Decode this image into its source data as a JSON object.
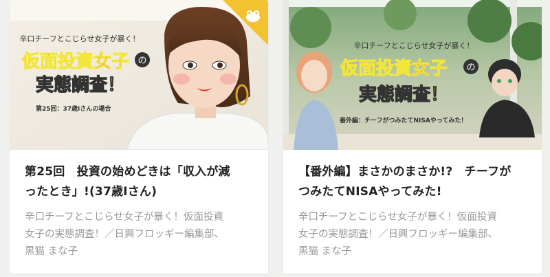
{
  "cards": [
    {
      "thumbnail": {
        "subtitle": "辛口チーフとこじらせ女子が暴く！",
        "title_line1": "仮面投資女子",
        "title_no": "の",
        "title_line2": "実態調査！",
        "caption": "第25回：37歳Iさんの場合",
        "badge_icon": "frog-icon"
      },
      "title_line1": "第25回　投資の始めどきは「収入が減",
      "title_line2": "ったとき」!(37歳Iさん)",
      "meta_line1": "辛口チーフとこじらせ女子が暴く！仮面投資",
      "meta_line2": "女子の実態調査！／日興フロッギー編集部、",
      "meta_line3": "黒猫 まな子"
    },
    {
      "thumbnail": {
        "subtitle": "辛口チーフとこじらせ女子が暴く！",
        "title_line1": "仮面投資女子",
        "title_no": "の",
        "title_line2": "実態調査！",
        "caption": "番外編：チーフがつみたてNISAやってみた！"
      },
      "title_line1": "【番外編】まさかのまさか!?　チーフが",
      "title_line2": "つみたてNISAやってみた!",
      "meta_line1": "辛口チーフとこじらせ女子が暴く！仮面投資",
      "meta_line2": "女子の実態調査！／日興フロッギー編集部、",
      "meta_line3": "黒猫 まな子"
    }
  ],
  "colors": {
    "title_magenta": "#c0287f",
    "title_yellow": "#f3e63a",
    "badge_yellow": "#f2c230",
    "text_dark": "#222222",
    "text_meta": "#999999"
  }
}
